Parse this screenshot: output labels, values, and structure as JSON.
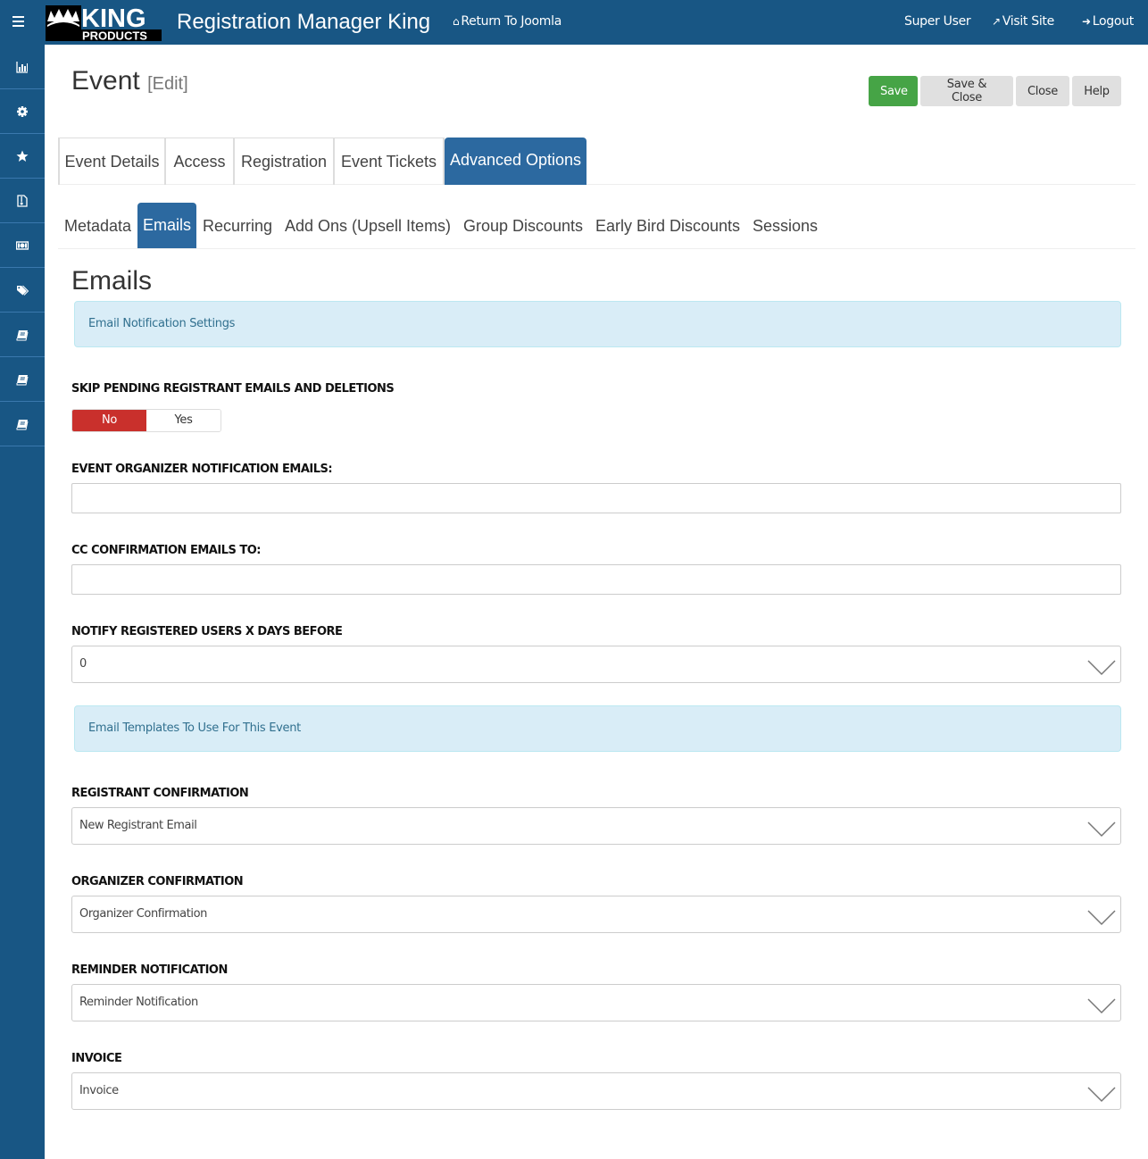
{
  "header": {
    "app_title": "Registration Manager King",
    "logo_text_top": "KING",
    "logo_text_bottom": "PRODUCTS",
    "nav": {
      "return_label": "Return To Joomla",
      "user_label": "Super User",
      "visit_label": "Visit Site",
      "logout_label": "Logout"
    },
    "icons": {
      "return": "home-icon",
      "visit": "external-link-icon",
      "logout": "sign-out-icon",
      "menu": "hamburger-icon"
    }
  },
  "sidebar": {
    "items": [
      {
        "icon": "bar-chart-icon"
      },
      {
        "icon": "gear-icon"
      },
      {
        "icon": "star-icon"
      },
      {
        "icon": "file-archive-icon"
      },
      {
        "icon": "money-icon"
      },
      {
        "icon": "tags-icon"
      },
      {
        "icon": "book-icon"
      },
      {
        "icon": "book-icon"
      },
      {
        "icon": "book-icon"
      }
    ]
  },
  "page": {
    "title": "Event",
    "subtitle": "[Edit]"
  },
  "toolbar": {
    "save_label": "Save",
    "save_close_label": "Save & Close",
    "close_label": "Close",
    "help_label": "Help"
  },
  "main_tabs": [
    {
      "label": "Event Details",
      "active": false
    },
    {
      "label": "Access",
      "active": false
    },
    {
      "label": "Registration",
      "active": false
    },
    {
      "label": "Event Tickets",
      "active": false
    },
    {
      "label": "Advanced Options",
      "active": true
    }
  ],
  "sub_tabs": [
    {
      "label": "Metadata",
      "active": false
    },
    {
      "label": "Emails",
      "active": true
    },
    {
      "label": "Recurring",
      "active": false
    },
    {
      "label": "Add Ons (Upsell Items)",
      "active": false
    },
    {
      "label": "Group Discounts",
      "active": false
    },
    {
      "label": "Early Bird Discounts",
      "active": false
    },
    {
      "label": "Sessions",
      "active": false
    }
  ],
  "emails": {
    "section_title": "Emails",
    "notification_alert": "Email Notification Settings",
    "skip_pending": {
      "label": "SKIP PENDING REGISTRANT EMAILS AND DELETIONS",
      "options": [
        "No",
        "Yes"
      ],
      "selected": "No"
    },
    "organizer_emails": {
      "label": "EVENT ORGANIZER NOTIFICATION EMAILS:",
      "value": ""
    },
    "cc_emails": {
      "label": "CC CONFIRMATION EMAILS TO:",
      "value": ""
    },
    "notify_days": {
      "label": "NOTIFY REGISTERED USERS X DAYS BEFORE",
      "value": "0"
    },
    "templates_alert": "Email Templates To Use For This Event",
    "registrant_confirmation": {
      "label": "REGISTRANT CONFIRMATION",
      "value": "New Registrant Email"
    },
    "organizer_confirmation": {
      "label": "ORGANIZER CONFIRMATION",
      "value": "Organizer Confirmation"
    },
    "reminder_notification": {
      "label": "REMINDER NOTIFICATION",
      "value": "Reminder Notification"
    },
    "invoice": {
      "label": "INVOICE",
      "value": "Invoice"
    }
  },
  "colors": {
    "navbar": "#185684",
    "tab_active": "#2c69a0",
    "save": "#46a446",
    "toggle_no": "#c9302c",
    "alert_bg": "#d9edf7",
    "alert_text": "#31708f"
  }
}
